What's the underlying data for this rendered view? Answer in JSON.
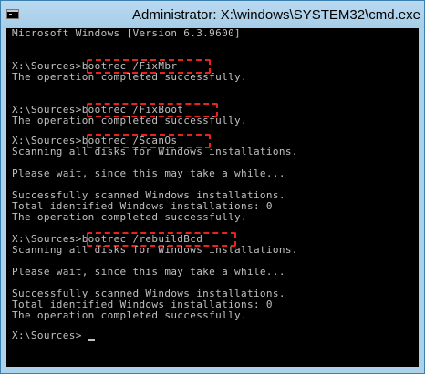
{
  "window": {
    "title": "Administrator: X:\\windows\\SYSTEM32\\cmd.exe",
    "icon": "cmd-icon"
  },
  "console": {
    "version_line": "Microsoft Windows [Version 6.3.9600]",
    "prompt": "X:\\Sources>",
    "commands": [
      {
        "command": "bootrec /FixMbr",
        "output": [
          "The operation completed successfully."
        ]
      },
      {
        "command": "bootrec /FixBoot",
        "output": [
          "The operation completed successfully."
        ]
      },
      {
        "command": "bootrec /ScanOs",
        "output": [
          "Scanning all disks for Windows installations.",
          "",
          "Please wait, since this may take a while...",
          "",
          "Successfully scanned Windows installations.",
          "Total identified Windows installations: 0",
          "The operation completed successfully."
        ]
      },
      {
        "command": "bootrec /rebuildBcd",
        "output": [
          "Scanning all disks for Windows installations.",
          "",
          "Please wait, since this may take a while...",
          "",
          "Successfully scanned Windows installations.",
          "Total identified Windows installations: 0",
          "The operation completed successfully."
        ]
      }
    ],
    "final_prompt": "X:\\Sources>"
  },
  "colors": {
    "title_bar": "#aed1ea",
    "console_bg": "#000000",
    "console_text": "#c0c0c0",
    "highlight_box": "#e8231c"
  }
}
